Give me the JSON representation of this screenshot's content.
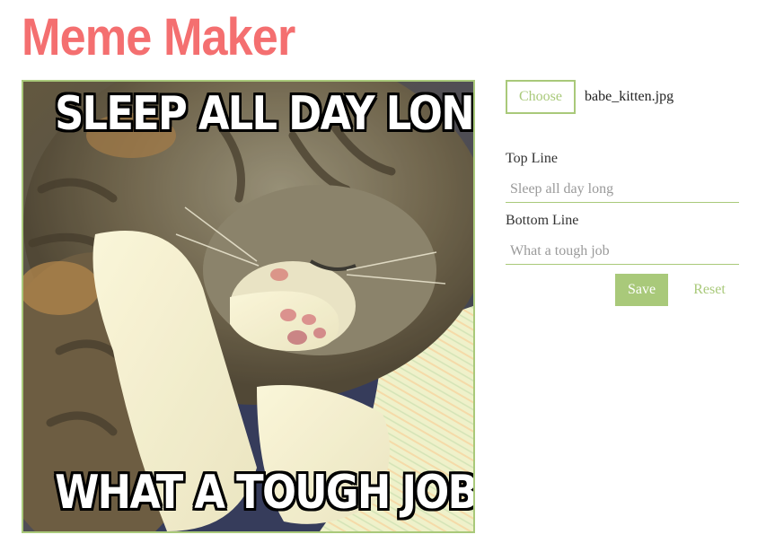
{
  "app": {
    "title": "Meme Maker"
  },
  "meme": {
    "top_text": "SLEEP ALL DAY LONG",
    "bottom_text": "WHAT A TOUGH JOB",
    "image_subject": "sleeping-kitten-photo"
  },
  "file": {
    "button_label": "Choose",
    "file_name": "babe_kitten.jpg"
  },
  "form": {
    "top_label": "Top Line",
    "top_placeholder": "Sleep all day long",
    "bottom_label": "Bottom Line",
    "bottom_placeholder": "What a tough job"
  },
  "actions": {
    "save_label": "Save",
    "reset_label": "Reset"
  },
  "colors": {
    "title": "#f46f70",
    "accent": "#a9c97a",
    "text": "#333333",
    "placeholder": "#9a9a9a"
  }
}
